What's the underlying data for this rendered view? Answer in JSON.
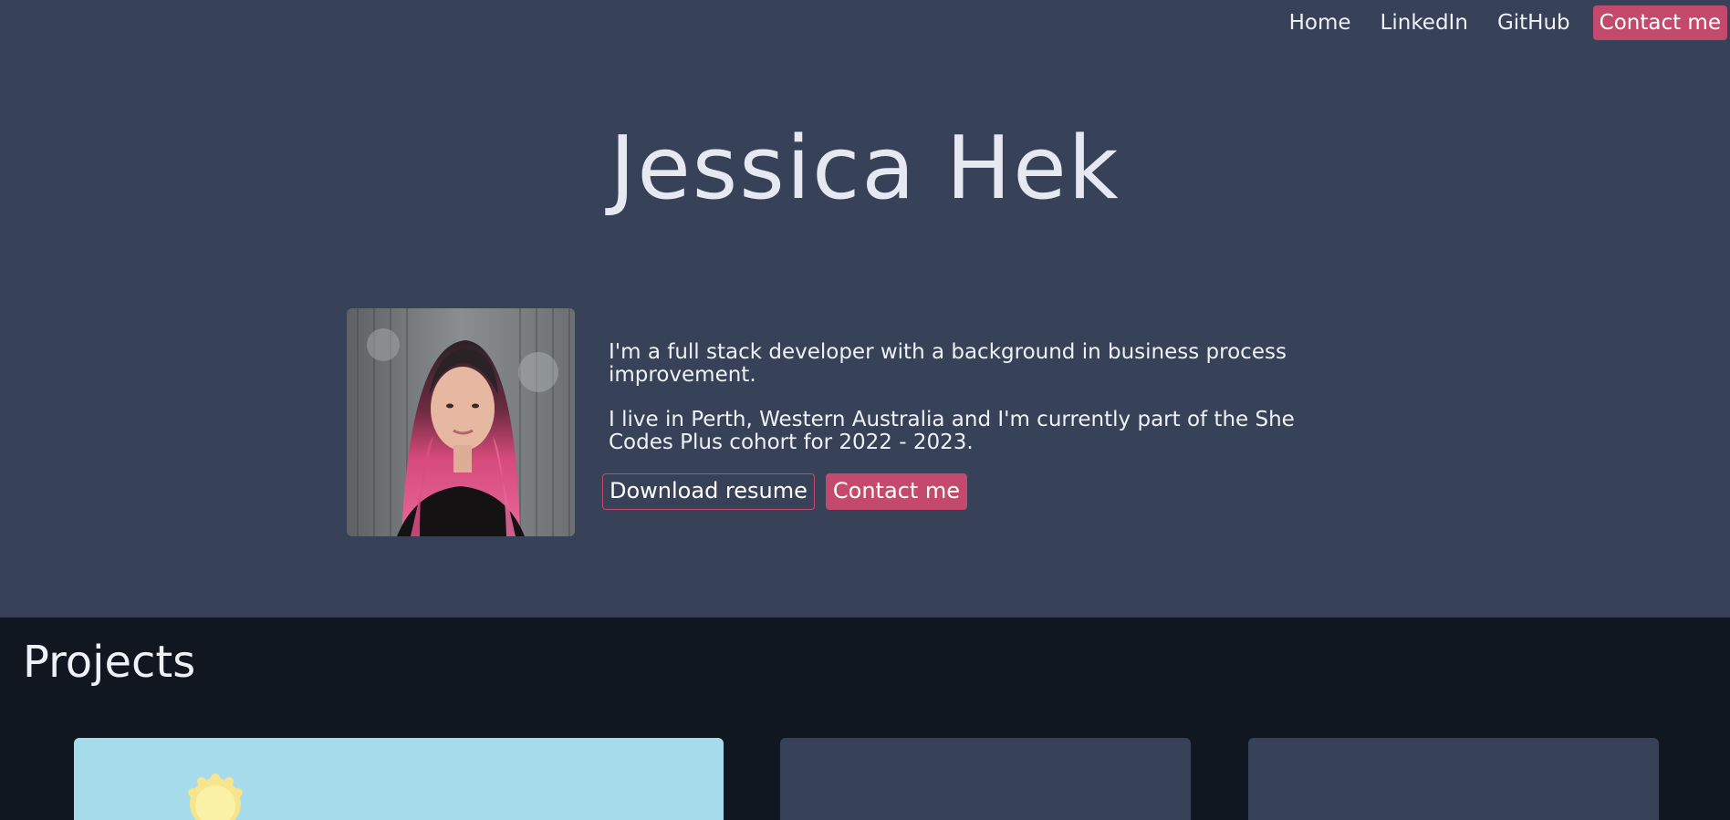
{
  "nav": {
    "items": [
      {
        "label": "Home"
      },
      {
        "label": "LinkedIn"
      },
      {
        "label": "GitHub"
      },
      {
        "label": "Contact me"
      }
    ]
  },
  "hero": {
    "name": "Jessica Hek",
    "bio": [
      "I'm a full stack developer with a background in business process improvement.",
      "I live in Perth, Western Australia and I'm currently part of the She Codes Plus cohort for 2022 - 2023."
    ],
    "actions": {
      "download_resume": "Download resume",
      "contact": "Contact me"
    }
  },
  "projects": {
    "title": "Projects"
  },
  "colors": {
    "hero_bg": "#374157",
    "page_bg": "#111720",
    "accent": "#c44a6d",
    "text": "#eef1f6"
  }
}
